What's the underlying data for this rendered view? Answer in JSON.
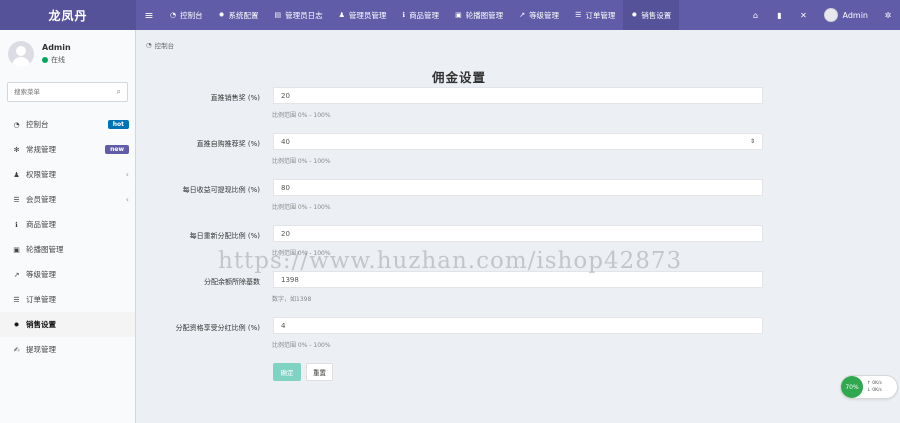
{
  "brand": {
    "logo": "龙凤丹"
  },
  "topnav": {
    "items": [
      {
        "label": "控制台",
        "icon": "dashboard-icon"
      },
      {
        "label": "系统配置",
        "icon": "gear-icon"
      },
      {
        "label": "管理员日志",
        "icon": "log-icon"
      },
      {
        "label": "管理员管理",
        "icon": "user-icon"
      },
      {
        "label": "商品管理",
        "icon": "info-icon"
      },
      {
        "label": "轮播图管理",
        "icon": "image-icon"
      },
      {
        "label": "等级管理",
        "icon": "chart-icon"
      },
      {
        "label": "订单管理",
        "icon": "list-icon"
      },
      {
        "label": "销售设置",
        "icon": "gear-icon"
      }
    ],
    "user": "Admin"
  },
  "sidebar": {
    "user_name": "Admin",
    "user_status": "在线",
    "search_placeholder": "搜索菜单",
    "items": [
      {
        "label": "控制台",
        "badge": "hot"
      },
      {
        "label": "常规管理",
        "badge": "new"
      },
      {
        "label": "权限管理",
        "caret": "‹"
      },
      {
        "label": "会员管理",
        "caret": "‹"
      },
      {
        "label": "商品管理"
      },
      {
        "label": "轮播图管理"
      },
      {
        "label": "等级管理"
      },
      {
        "label": "订单管理"
      },
      {
        "label": "销售设置"
      },
      {
        "label": "提现管理"
      }
    ]
  },
  "breadcrumb": "控制台",
  "form": {
    "title": "佣金设置",
    "fields": [
      {
        "label": "直推销售奖 (%)",
        "value": "20",
        "help": "比例范围 0% - 100%"
      },
      {
        "label": "直推自购推荐奖 (%)",
        "value": "40",
        "help": "比例范围 0% - 100%"
      },
      {
        "label": "每日收益可提现比例 (%)",
        "value": "80",
        "help": "比例范围 0% - 100%"
      },
      {
        "label": "每日重新分配比例 (%)",
        "value": "20",
        "help": "比例范围 0% - 100%"
      },
      {
        "label": "分配余额所除基数",
        "value": "1398",
        "help": "数字，如1398"
      },
      {
        "label": "分配资格享受分红比例 (%)",
        "value": "4",
        "help": "比例范围 0% - 100%"
      }
    ],
    "ok_label": "确定",
    "reset_label": "重置"
  },
  "watermark": "https://www.huzhan.com/ishop42873",
  "widget": {
    "circle": "70%",
    "up": "0K/s",
    "down": "0K/s"
  }
}
